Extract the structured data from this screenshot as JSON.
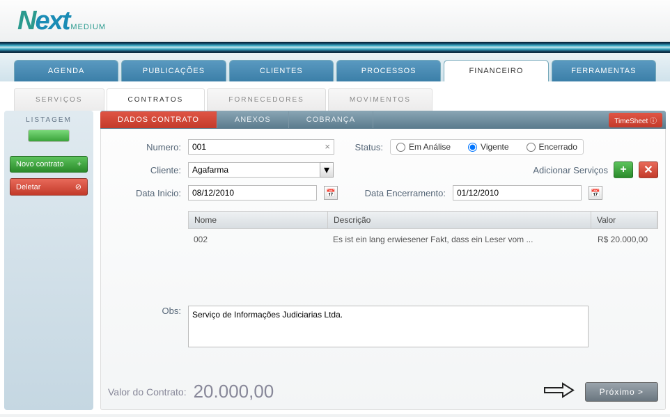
{
  "logo": {
    "n": "N",
    "ext": "ext",
    "medium": "MEDIUM"
  },
  "main_tabs": [
    "AGENDA",
    "PUBLICAÇÕES",
    "CLIENTES",
    "PROCESSOS",
    "FINANCEIRO",
    "FERRAMENTAS"
  ],
  "main_tab_active": 4,
  "sub_tabs": [
    "SERVIÇOS",
    "CONTRATOS",
    "FORNECEDORES",
    "MOVIMENTOS"
  ],
  "sub_tab_active": 1,
  "sidebar": {
    "listagem": "LISTAGEM",
    "novo": "Novo contrato",
    "deletar": "Deletar"
  },
  "panel_tabs": [
    "DADOS CONTRATO",
    "ANEXOS",
    "COBRANÇA"
  ],
  "panel_tab_active": 0,
  "timesheet": "TimeSheet ⓘ",
  "form": {
    "numero_label": "Numero:",
    "numero_value": "001",
    "status_label": "Status:",
    "status_options": [
      "Em Análise",
      "Vigente",
      "Encerrado"
    ],
    "status_selected": 1,
    "cliente_label": "Cliente:",
    "cliente_value": "Agafarma",
    "adicionar_servicos": "Adicionar Serviços",
    "data_inicio_label": "Data Inicio:",
    "data_inicio_value": "08/12/2010",
    "data_encerramento_label": "Data Encerramento:",
    "data_encerramento_value": "01/12/2010",
    "obs_label": "Obs:",
    "obs_value": "Serviço de Informações Judiciarias Ltda."
  },
  "table": {
    "headers": [
      "Nome",
      "Descrição",
      "Valor"
    ],
    "rows": [
      {
        "nome": "002",
        "descricao": "Es ist ein lang erwiesener Fakt, dass ein Leser vom ...",
        "valor": "R$ 20.000,00"
      }
    ]
  },
  "footer": {
    "valor_label": "Valor do Contrato:",
    "valor_amount": "20.000,00",
    "proximo": "Próximo >"
  }
}
